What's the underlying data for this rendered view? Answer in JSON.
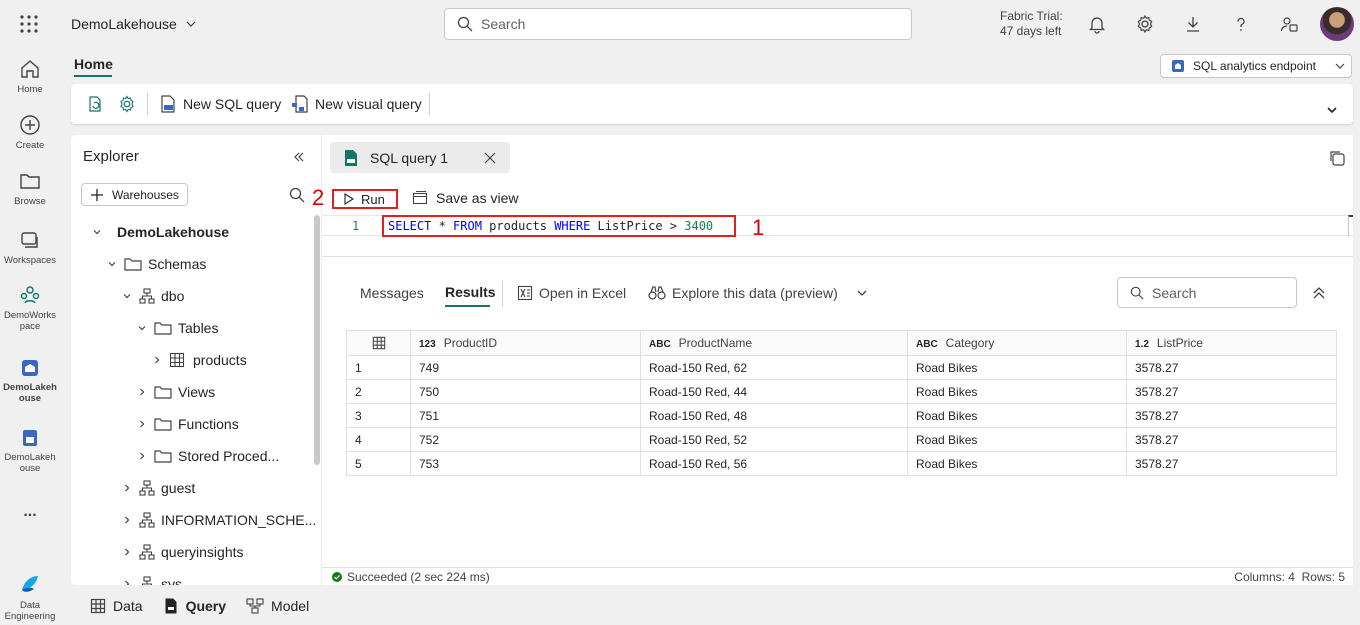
{
  "app": {
    "workspace_item": "DemoLakehouse",
    "search_placeholder": "Search",
    "trial_line1": "Fabric Trial:",
    "trial_line2": "47 days left"
  },
  "rail": [
    {
      "label": "Home",
      "icon": "home-icon"
    },
    {
      "label": "Create",
      "icon": "plus-circle-icon"
    },
    {
      "label": "Browse",
      "icon": "folder-icon"
    },
    {
      "label": "Workspaces",
      "icon": "workspaces-icon"
    },
    {
      "label": "DemoWorks pace",
      "icon": "workspace-people-icon"
    },
    {
      "label": "DemoLakeh ouse",
      "icon": "lakehouse-icon"
    },
    {
      "label": "DemoLakeh ouse",
      "icon": "sql-endpoint-icon"
    },
    {
      "label": "...",
      "icon": "more-icon"
    },
    {
      "label": "Data Engineering",
      "icon": "fabric-logo-icon"
    }
  ],
  "header": {
    "home_tab": "Home",
    "endpoint_label": "SQL analytics endpoint"
  },
  "ribbon": {
    "new_sql_query": "New SQL query",
    "new_visual_query": "New visual query"
  },
  "explorer": {
    "title": "Explorer",
    "warehouses_btn": "Warehouses",
    "tree": {
      "root": "DemoLakehouse",
      "schemas": "Schemas",
      "dbo": "dbo",
      "tables": "Tables",
      "products": "products",
      "views": "Views",
      "functions": "Functions",
      "stored": "Stored Proced...",
      "guest": "guest",
      "info_schema": "INFORMATION_SCHE...",
      "queryinsights": "queryinsights",
      "sys": "sys"
    }
  },
  "editor": {
    "tab_label": "SQL query 1",
    "run_label": "Run",
    "save_view_label": "Save as view",
    "line_number": "1",
    "code": {
      "k1": "SELECT",
      "t1": " * ",
      "k2": "FROM",
      "t2": " products ",
      "k3": "WHERE",
      "t3": " ListPrice > ",
      "n1": "3400"
    },
    "callout_1": "1",
    "callout_2": "2"
  },
  "results": {
    "tabs": {
      "messages": "Messages",
      "results": "Results",
      "open_excel": "Open in Excel",
      "explore": "Explore this data (preview)"
    },
    "search_placeholder": "Search",
    "columns": [
      {
        "type": "123",
        "name": "ProductID"
      },
      {
        "type": "ABC",
        "name": "ProductName"
      },
      {
        "type": "ABC",
        "name": "Category"
      },
      {
        "type": "1.2",
        "name": "ListPrice"
      }
    ],
    "rows": [
      [
        "1",
        "749",
        "Road-150 Red, 62",
        "Road Bikes",
        "3578.27"
      ],
      [
        "2",
        "750",
        "Road-150 Red, 44",
        "Road Bikes",
        "3578.27"
      ],
      [
        "3",
        "751",
        "Road-150 Red, 48",
        "Road Bikes",
        "3578.27"
      ],
      [
        "4",
        "752",
        "Road-150 Red, 52",
        "Road Bikes",
        "3578.27"
      ],
      [
        "5",
        "753",
        "Road-150 Red, 56",
        "Road Bikes",
        "3578.27"
      ]
    ],
    "status": "Succeeded (2 sec 224 ms)",
    "summary": "Columns: 4  Rows: 5"
  },
  "bottom_tabs": {
    "data": "Data",
    "query": "Query",
    "model": "Model"
  },
  "colors": {
    "accent": "#117865",
    "highlight": "#e01f1f"
  }
}
